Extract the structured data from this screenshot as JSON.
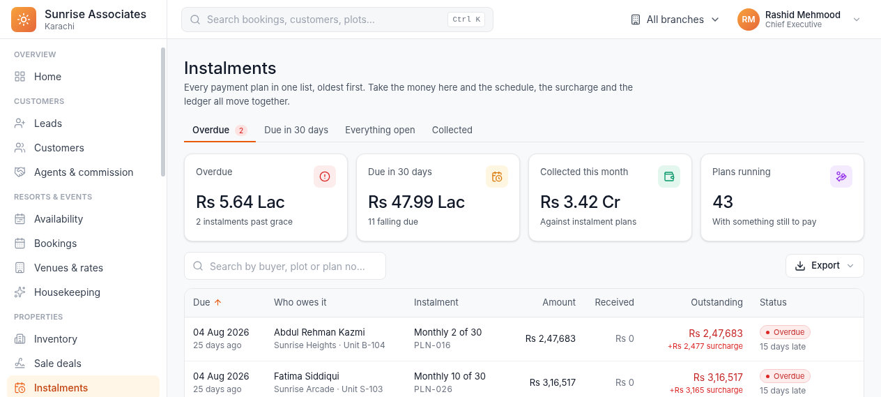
{
  "brand": {
    "name": "Sunrise Associates",
    "city": "Karachi"
  },
  "sidebar": {
    "sections": [
      {
        "title": "OVERVIEW",
        "items": [
          {
            "label": "Home",
            "kind": "home",
            "selected": false
          }
        ]
      },
      {
        "title": "CUSTOMERS",
        "items": [
          {
            "label": "Leads",
            "kind": "leads",
            "selected": false
          },
          {
            "label": "Customers",
            "kind": "customers",
            "selected": false
          },
          {
            "label": "Agents & commission",
            "kind": "agents",
            "selected": false
          }
        ]
      },
      {
        "title": "RESORTS & EVENTS",
        "items": [
          {
            "label": "Availability",
            "kind": "availability",
            "selected": false
          },
          {
            "label": "Bookings",
            "kind": "bookings",
            "selected": false
          },
          {
            "label": "Venues & rates",
            "kind": "venues",
            "selected": false
          },
          {
            "label": "Housekeeping",
            "kind": "housekeeping",
            "selected": false
          }
        ]
      },
      {
        "title": "PROPERTIES",
        "items": [
          {
            "label": "Inventory",
            "kind": "inventory",
            "selected": false
          },
          {
            "label": "Sale deals",
            "kind": "deals",
            "selected": false
          },
          {
            "label": "Instalments",
            "kind": "instalments",
            "selected": true
          }
        ]
      }
    ]
  },
  "topbar": {
    "search": {
      "placeholder": "Search bookings, customers, plots...",
      "shortcut": "Ctrl K"
    },
    "branch": "All branches",
    "user": {
      "initials": "RM",
      "name": "Rashid Mehmood",
      "role": "Chief Executive"
    }
  },
  "page": {
    "title": "Instalments",
    "description": "Every payment plan in one list, oldest first. Take the money here and the schedule, the surcharge and the ledger all move together."
  },
  "tabs": [
    {
      "label": "Overdue",
      "count": "2",
      "selected": true
    },
    {
      "label": "Due in 30 days",
      "selected": false
    },
    {
      "label": "Everything open",
      "selected": false
    },
    {
      "label": "Collected",
      "selected": false
    }
  ],
  "cards": [
    {
      "kind": "overdue",
      "label": "Overdue",
      "value": "Rs 5.64 Lac",
      "note": "2 instalments past grace"
    },
    {
      "kind": "due",
      "label": "Due in 30 days",
      "value": "Rs 47.99 Lac",
      "note": "11 falling due"
    },
    {
      "kind": "collected",
      "label": "Collected this month",
      "value": "Rs 3.42 Cr",
      "note": "Against instalment plans"
    },
    {
      "kind": "plans",
      "label": "Plans running",
      "value": "43",
      "note": "With something still to pay"
    }
  ],
  "filter": {
    "placeholder": "Search by buyer, plot or plan no..."
  },
  "export": "Export",
  "table": {
    "columns": [
      {
        "label": "Due",
        "sorted": true
      },
      {
        "label": "Who owes it",
        "sorted": false
      },
      {
        "label": "Instalment",
        "sorted": false
      },
      {
        "label": "Amount",
        "sorted": false
      },
      {
        "label": "Received",
        "sorted": false
      },
      {
        "label": "Outstanding",
        "sorted": false
      },
      {
        "label": "Status",
        "sorted": false
      }
    ],
    "rows": [
      {
        "due": "04 Aug 2026",
        "ago": "25 days ago",
        "name": "Abdul Rehman Kazmi",
        "location": "Sunrise Heights · Unit B-104",
        "instalment": "Monthly 2 of 30",
        "plan": "PLN-016",
        "amount": "Rs 2,47,683",
        "received": "Rs 0",
        "outstanding": "Rs 2,47,683",
        "surcharge": "+Rs 2,477 surcharge",
        "status": {
          "kind": "overdue",
          "label": "Overdue"
        },
        "late": "15 days late"
      },
      {
        "due": "04 Aug 2026",
        "ago": "25 days ago",
        "name": "Fatima Siddiqui",
        "location": "Sunrise Arcade · Unit S-103",
        "instalment": "Monthly 10 of 30",
        "plan": "PLN-026",
        "amount": "Rs 3,16,517",
        "received": "Rs 0",
        "outstanding": "Rs 3,16,517",
        "surcharge": "+Rs 3,165 surcharge",
        "status": {
          "kind": "overdue",
          "label": "Overdue"
        },
        "late": "15 days late"
      }
    ]
  }
}
